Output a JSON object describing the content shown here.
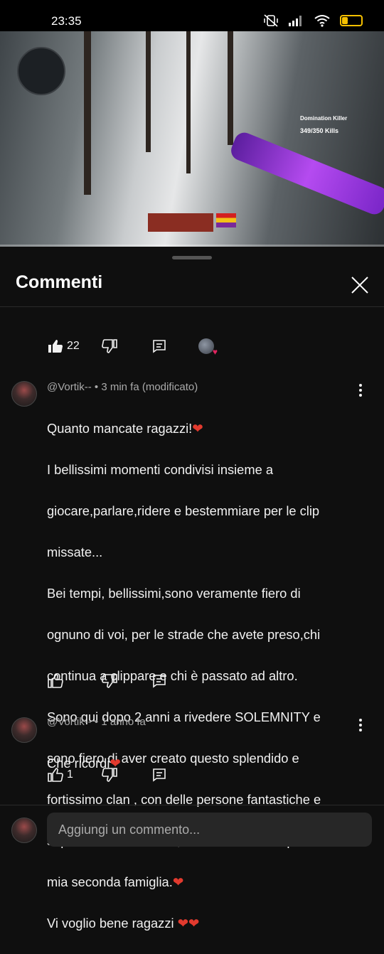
{
  "status_bar": {
    "time": "23:35",
    "battery_level": "30",
    "icons": [
      "mute-vibrate-icon",
      "signal-icon",
      "wifi-icon",
      "battery-icon"
    ]
  },
  "video": {
    "hud_score": "349/350 Kills",
    "hud_label": "Domination Killer"
  },
  "panel": {
    "title": "Commenti",
    "close_icon": "close-icon"
  },
  "top_actions": {
    "like_count": "22",
    "icons": [
      "thumb-up-filled-icon",
      "thumb-down-icon",
      "reply-icon"
    ]
  },
  "comments": [
    {
      "author": "@Vortik--",
      "meta": " • 3 min fa (modificato)",
      "lines": [
        "Quanto mancate ragazzi!",
        "I bellissimi momenti condivisi insieme a",
        "giocare,parlare,ridere e bestemmiare per le clip",
        "missate...",
        "Bei tempi, bellissimi,sono veramente fiero di",
        "ognuno di voi, per le strade che avete preso,chi",
        "continua a clippare e chi è passato ad altro.",
        "Sono qui dopo 2 anni a rivedere SOLEMNITY e",
        "sono fiero di aver creato questo splendido e",
        "fortissimo clan , con delle persone fantastiche e",
        "soprattutto ottimi amici,siete e sarete sempre la",
        "mia seconda famiglia.",
        "Vi voglio bene ragazzi "
      ],
      "like_count": ""
    },
    {
      "author": "@Vortik--",
      "meta": " • 1 anno fa",
      "lines": [
        "Che ricordi"
      ],
      "like_count": "1"
    }
  ],
  "composer": {
    "placeholder": "Aggiungi un commento..."
  },
  "colors": {
    "background": "#0f0f0f",
    "heart": "#e23a2e",
    "battery": "#f5c000",
    "muted_text": "#aaaaaa"
  }
}
